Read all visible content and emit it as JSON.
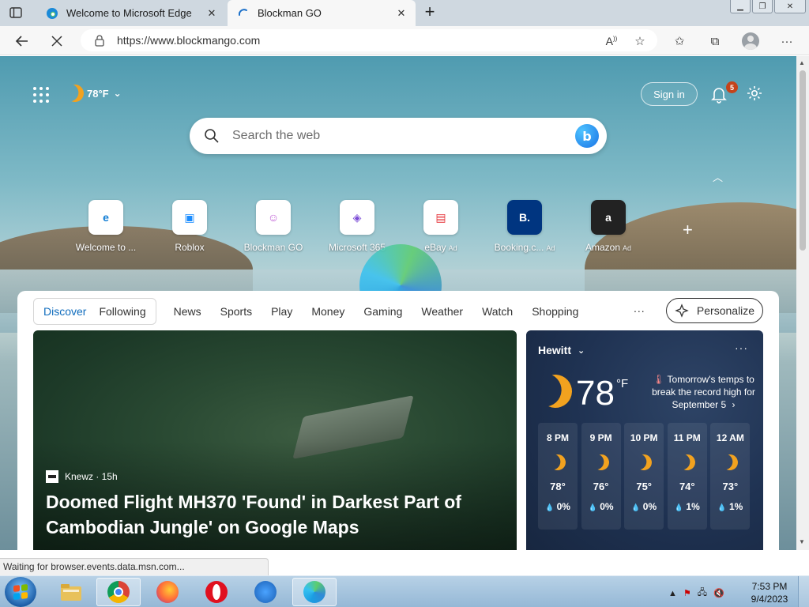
{
  "browser": {
    "tabs": [
      {
        "title": "Welcome to Microsoft Edge",
        "active": false,
        "icon": "edge-icon"
      },
      {
        "title": "Blockman GO",
        "active": true,
        "icon": "loading-spinner-icon"
      }
    ],
    "address": {
      "url": "https://www.blockmango.com"
    }
  },
  "header": {
    "weather_temp": "78°F",
    "signin_label": "Sign in",
    "notification_count": "5"
  },
  "search": {
    "placeholder": "Search the web"
  },
  "quicklinks": [
    {
      "label": "Welcome to ...",
      "ad": "",
      "glyph": "e",
      "color": "#0f7cd4"
    },
    {
      "label": "Roblox",
      "ad": "",
      "glyph": "▣",
      "color": "#1a8cff"
    },
    {
      "label": "Blockman GO",
      "ad": "",
      "glyph": "☺",
      "color": "#c05fd6"
    },
    {
      "label": "Microsoft 365",
      "ad": "",
      "glyph": "◈",
      "color": "#7c4dd6"
    },
    {
      "label": "eBay",
      "ad": "Ad",
      "glyph": "▤",
      "color": "#e53238"
    },
    {
      "label": "Booking.c...",
      "ad": "Ad",
      "glyph": "B.",
      "color": "#003580"
    },
    {
      "label": "Amazon",
      "ad": "Ad",
      "glyph": "a",
      "color": "#ffffff"
    }
  ],
  "feed": {
    "tabs_group": [
      "Discover",
      "Following"
    ],
    "tabs": [
      "News",
      "Sports",
      "Play",
      "Money",
      "Gaming",
      "Weather",
      "Watch",
      "Shopping"
    ],
    "more": "...",
    "personalize_label": "Personalize"
  },
  "hero": {
    "source": "Knewz · 15h",
    "headline": "Doomed Flight MH370 'Found' in Darkest Part of Cambodian Jungle' on Google Maps"
  },
  "weather_card": {
    "location": "Hewitt",
    "temp": "78",
    "unit": "°F",
    "alert": "Tomorrow's temps to break the record high for September 5",
    "hourly": [
      {
        "time": "8 PM",
        "temp": "78°",
        "precip": "0%"
      },
      {
        "time": "9 PM",
        "temp": "76°",
        "precip": "0%"
      },
      {
        "time": "10 PM",
        "temp": "75°",
        "precip": "0%"
      },
      {
        "time": "11 PM",
        "temp": "74°",
        "precip": "1%"
      },
      {
        "time": "12 AM",
        "temp": "73°",
        "precip": "1%"
      }
    ]
  },
  "status_text": "Waiting for browser.events.data.msn.com...",
  "taskbar": {
    "time": "7:53 PM",
    "date": "9/4/2023"
  }
}
